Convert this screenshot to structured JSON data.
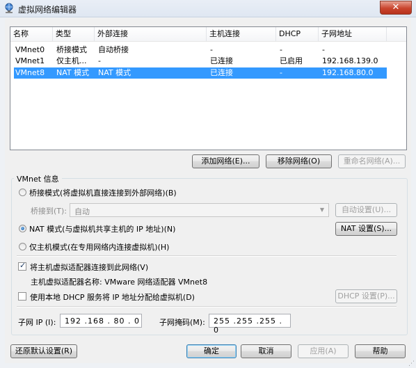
{
  "window": {
    "title": "虚拟网络编辑器",
    "close_glyph": "✕"
  },
  "table": {
    "headers": [
      "名称",
      "类型",
      "外部连接",
      "主机连接",
      "DHCP",
      "子网地址"
    ],
    "rows": [
      [
        "VMnet0",
        "桥接模式",
        "自动桥接",
        "-",
        "-",
        "-"
      ],
      [
        "VMnet1",
        "仅主机...",
        "-",
        "已连接",
        "已启用",
        "192.168.139.0"
      ],
      [
        "VMnet8",
        "NAT 模式",
        "NAT 模式",
        "已连接",
        "-",
        "192.168.80.0"
      ]
    ],
    "selected_row": 2
  },
  "list_buttons": {
    "add": "添加网络(E)...",
    "remove": "移除网络(O)",
    "rename": "重命名网络(A)..."
  },
  "info": {
    "group_title": "VMnet 信息",
    "bridge_mode": "桥接模式(将虚拟机直接连接到外部网络)(B)",
    "bridge_to_label": "桥接到(T):",
    "bridge_to_value": "自动",
    "auto_settings": "自动设置(U)...",
    "nat_mode": "NAT 模式(与虚拟机共享主机的 IP 地址)(N)",
    "nat_settings": "NAT 设置(S)...",
    "host_only_mode": "仅主机模式(在专用网络内连接虚拟机)(H)",
    "connect_adapter": "将主机虚拟适配器连接到此网络(V)",
    "adapter_name": "主机虚拟适配器名称: VMware 网络适配器 VMnet8",
    "use_dhcp": "使用本地 DHCP 服务将 IP 地址分配给虚拟机(D)",
    "dhcp_settings": "DHCP 设置(P)...",
    "subnet_ip_label": "子网 IP (I):",
    "subnet_ip": "192 .168 . 80 . 0",
    "subnet_mask_label": "子网掩码(M):",
    "subnet_mask": "255 .255 .255 . 0",
    "selected_mode": "nat",
    "connect_adapter_checked": true,
    "use_dhcp_checked": false
  },
  "footer": {
    "restore": "还原默认设置(R)",
    "ok": "确定",
    "cancel": "取消",
    "apply": "应用(A)",
    "help": "帮助"
  },
  "colors": {
    "selection": "#3399ff",
    "close_button": "#c9452e"
  },
  "icons": {
    "app": "network-globe-icon",
    "dropdown": "chevron-down-icon",
    "grip": "resize-grip-icon"
  }
}
